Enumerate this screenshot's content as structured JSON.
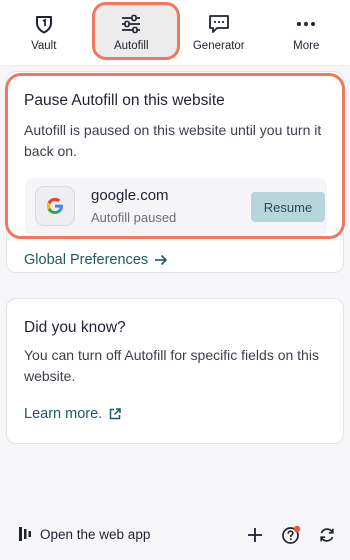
{
  "nav": {
    "items": [
      {
        "label": "Vault",
        "icon": "vault-shield-icon"
      },
      {
        "label": "Autofill",
        "icon": "sliders-icon"
      },
      {
        "label": "Generator",
        "icon": "generator-chat-icon"
      },
      {
        "label": "More",
        "icon": "more-dots-icon"
      }
    ],
    "active": "Autofill"
  },
  "pause": {
    "title": "Pause Autofill on this website",
    "description": "Autofill is paused on this website until you turn it back on.",
    "site": {
      "name": "google.com",
      "status": "Autofill paused",
      "logo_icon": "google-logo-icon"
    },
    "resume_label": "Resume",
    "global_link": "Global Preferences"
  },
  "tip": {
    "title": "Did you know?",
    "description": "You can turn off Autofill for specific fields on this website.",
    "learn_more": "Learn more."
  },
  "bottom": {
    "open_app": "Open the web app"
  },
  "colors": {
    "accent_link": "#1c5a66",
    "resume_bg": "#b7d6dc",
    "highlight": "#f0785e",
    "notification_dot": "#e8553a"
  }
}
